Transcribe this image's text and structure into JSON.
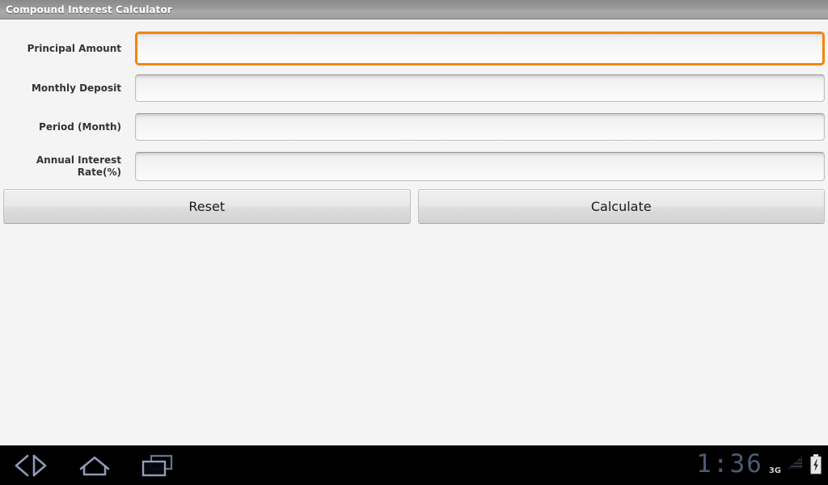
{
  "titlebar": {
    "title": "Compound Interest Calculator"
  },
  "form": {
    "fields": [
      {
        "label": "Principal Amount",
        "value": "",
        "placeholder": "",
        "focused": true,
        "name": "principal-amount"
      },
      {
        "label": "Monthly Deposit",
        "value": "",
        "placeholder": "",
        "focused": false,
        "name": "monthly-deposit"
      },
      {
        "label": "Period (Month)",
        "value": "",
        "placeholder": "",
        "focused": false,
        "name": "period-month"
      },
      {
        "label": "Annual Interest Rate(%)",
        "value": "",
        "placeholder": "",
        "focused": false,
        "name": "annual-interest-rate"
      }
    ],
    "buttons": {
      "reset_label": "Reset",
      "calculate_label": "Calculate"
    }
  },
  "systembar": {
    "nav": {
      "back_icon": "back-icon",
      "home_icon": "home-icon",
      "recents_icon": "recent-apps-icon"
    },
    "status": {
      "clock": "1:36",
      "network": "3G",
      "signal_icon": "signal-bars-icon",
      "battery_icon": "battery-charging-icon"
    }
  },
  "colors": {
    "accent_focus": "#f2850e",
    "titlebar_text": "#ffffff",
    "page_background": "#f4f4f4",
    "systembar_background": "#000000",
    "clock_text": "#4e5a73"
  }
}
